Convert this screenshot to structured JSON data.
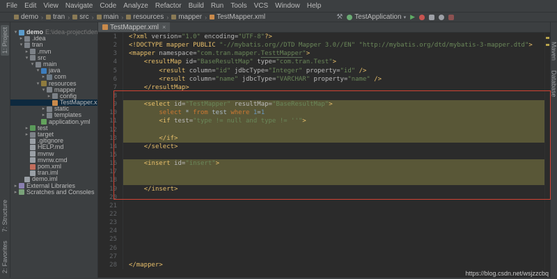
{
  "window": {
    "menu": [
      "File",
      "Edit",
      "View",
      "Navigate",
      "Code",
      "Analyze",
      "Refactor",
      "Build",
      "Run",
      "Tools",
      "VCS",
      "Window",
      "Help"
    ],
    "breadcrumbs": [
      "demo",
      "tran",
      "src",
      "main",
      "resources",
      "mapper",
      "TestMapper.xml"
    ],
    "run_config": "TestApplication",
    "watermark": "https://blog.csdn.net/wsjzzcbq"
  },
  "strips": {
    "left_top": [
      "1: Project"
    ],
    "left_bottom": [
      "7: Structure",
      "2: Favorites"
    ],
    "right": [
      "Maven",
      "Database"
    ]
  },
  "project": {
    "tree": [
      {
        "label": "demo",
        "hint": "E:\\idea-project\\demo",
        "level": 0,
        "arrow": "down",
        "icon": "project",
        "bold": true
      },
      {
        "label": ".idea",
        "level": 1,
        "arrow": "right",
        "icon": "folder"
      },
      {
        "label": "tran",
        "level": 1,
        "arrow": "down",
        "icon": "folder"
      },
      {
        "label": ".mvn",
        "level": 2,
        "arrow": "right",
        "icon": "folder"
      },
      {
        "label": "src",
        "level": 2,
        "arrow": "down",
        "icon": "folder"
      },
      {
        "label": "main",
        "level": 3,
        "arrow": "down",
        "icon": "folder"
      },
      {
        "label": "java",
        "level": 4,
        "arrow": "down",
        "icon": "src"
      },
      {
        "label": "com",
        "level": 5,
        "arrow": "right",
        "icon": "package"
      },
      {
        "label": "resources",
        "level": 4,
        "arrow": "down",
        "icon": "res"
      },
      {
        "label": "mapper",
        "level": 5,
        "arrow": "down",
        "icon": "folder"
      },
      {
        "label": "config",
        "level": 6,
        "arrow": "right",
        "icon": "folder"
      },
      {
        "label": "TestMapper.xml",
        "level": 6,
        "icon": "xml",
        "selected": true
      },
      {
        "label": "static",
        "level": 5,
        "arrow": "right",
        "icon": "folder"
      },
      {
        "label": "templates",
        "level": 5,
        "arrow": "right",
        "icon": "folder"
      },
      {
        "label": "application.yml",
        "level": 4,
        "icon": "yml"
      },
      {
        "label": "test",
        "level": 2,
        "arrow": "right",
        "icon": "testfolder"
      },
      {
        "label": "target",
        "level": 2,
        "arrow": "right",
        "icon": "folder"
      },
      {
        "label": ".gitignore",
        "level": 2,
        "icon": "file"
      },
      {
        "label": "HELP.md",
        "level": 2,
        "icon": "file"
      },
      {
        "label": "mvnw",
        "level": 2,
        "icon": "file"
      },
      {
        "label": "mvnw.cmd",
        "level": 2,
        "icon": "file"
      },
      {
        "label": "pom.xml",
        "level": 2,
        "icon": "maven"
      },
      {
        "label": "tran.iml",
        "level": 2,
        "icon": "file"
      },
      {
        "label": "demo.iml",
        "level": 1,
        "icon": "file"
      },
      {
        "label": "External Libraries",
        "level": 0,
        "arrow": "right",
        "icon": "lib"
      },
      {
        "label": "Scratches and Consoles",
        "level": 0,
        "arrow": "right",
        "icon": "scratch"
      }
    ]
  },
  "editor": {
    "tab": "TestMapper.xml",
    "lines": [
      {
        "n": 1,
        "seg": [
          [
            "t",
            "<?xml "
          ],
          [
            "a",
            "version="
          ],
          [
            "s",
            "\"1.0\""
          ],
          [
            "a",
            " encoding="
          ],
          [
            "s",
            "\"UTF-8\""
          ],
          [
            "t",
            "?>"
          ]
        ]
      },
      {
        "n": 2,
        "seg": [
          [
            "t",
            "<!DOCTYPE mapper PUBLIC "
          ],
          [
            "s",
            "\"-//mybatis.org//DTD Mapper 3.0//EN\""
          ],
          [
            "p",
            " "
          ],
          [
            "s",
            "\"http://mybatis.org/dtd/mybatis-3-mapper.dtd\""
          ],
          [
            "t",
            ">"
          ]
        ]
      },
      {
        "n": 3,
        "seg": [
          [
            "t",
            "<mapper "
          ],
          [
            "a",
            "namespace="
          ],
          [
            "s",
            "\"com.tran.mapper."
          ],
          [
            "su",
            "TesttMapper"
          ],
          [
            "s",
            "\""
          ],
          [
            "t",
            ">"
          ]
        ]
      },
      {
        "n": 4,
        "seg": [
          [
            "p",
            "    "
          ],
          [
            "t",
            "<resultMap "
          ],
          [
            "a",
            "id="
          ],
          [
            "s",
            "\"BaseResultMap\""
          ],
          [
            "a",
            " type="
          ],
          [
            "s",
            "\"com.tran.Test\""
          ],
          [
            "t",
            ">"
          ]
        ]
      },
      {
        "n": 5,
        "seg": [
          [
            "p",
            "        "
          ],
          [
            "t",
            "<result "
          ],
          [
            "a",
            "column="
          ],
          [
            "s",
            "\"id\""
          ],
          [
            "a",
            " jdbcType="
          ],
          [
            "s",
            "\"Integer\""
          ],
          [
            "a",
            " property="
          ],
          [
            "s",
            "\"id\""
          ],
          [
            "t",
            " />"
          ]
        ]
      },
      {
        "n": 6,
        "seg": [
          [
            "p",
            "        "
          ],
          [
            "t",
            "<result "
          ],
          [
            "a",
            "column="
          ],
          [
            "s",
            "\"name\""
          ],
          [
            "a",
            " jdbcType="
          ],
          [
            "s",
            "\"VARCHAR\""
          ],
          [
            "a",
            " property="
          ],
          [
            "s",
            "\"name\""
          ],
          [
            "t",
            " />"
          ]
        ]
      },
      {
        "n": 7,
        "seg": [
          [
            "p",
            "    "
          ],
          [
            "t",
            "</resultMap>"
          ]
        ]
      },
      {
        "n": 8,
        "seg": []
      },
      {
        "n": 9,
        "hl": true,
        "seg": [
          [
            "p",
            "    "
          ],
          [
            "t",
            "<select "
          ],
          [
            "a",
            "id="
          ],
          [
            "s",
            "\"TestMapper\""
          ],
          [
            "a",
            " resultMap="
          ],
          [
            "s",
            "\"BaseResultMap\""
          ],
          [
            "t",
            ">"
          ]
        ]
      },
      {
        "n": 10,
        "hl": true,
        "seg": [
          [
            "p",
            "        "
          ],
          [
            "k",
            "select"
          ],
          [
            "p",
            " * "
          ],
          [
            "k",
            "from"
          ],
          [
            "p",
            " test "
          ],
          [
            "k",
            "where"
          ],
          [
            "p",
            " "
          ],
          [
            "d",
            "1"
          ],
          [
            "p",
            "="
          ],
          [
            "d",
            "1"
          ]
        ]
      },
      {
        "n": 11,
        "hl": true,
        "seg": [
          [
            "p",
            "        "
          ],
          [
            "t",
            "<if "
          ],
          [
            "a",
            "test="
          ],
          [
            "s",
            "\"type != null and type != ''\""
          ],
          [
            "t",
            ">"
          ]
        ]
      },
      {
        "n": 12,
        "hl": true,
        "seg": []
      },
      {
        "n": 13,
        "hl": true,
        "seg": [
          [
            "p",
            "        "
          ],
          [
            "t",
            "</if>"
          ]
        ]
      },
      {
        "n": 14,
        "seg": [
          [
            "p",
            "    "
          ],
          [
            "t",
            "</select>"
          ]
        ]
      },
      {
        "n": 15,
        "seg": []
      },
      {
        "n": 16,
        "hl": true,
        "seg": [
          [
            "p",
            "    "
          ],
          [
            "t",
            "<insert "
          ],
          [
            "a",
            "id="
          ],
          [
            "s",
            "\"insert\""
          ],
          [
            "t",
            ">"
          ]
        ]
      },
      {
        "n": 17,
        "hl": true,
        "seg": []
      },
      {
        "n": 18,
        "hl": true,
        "seg": []
      },
      {
        "n": 19,
        "seg": [
          [
            "p",
            "    "
          ],
          [
            "t",
            "</insert>"
          ]
        ]
      },
      {
        "n": 20,
        "seg": []
      },
      {
        "n": 21,
        "seg": []
      },
      {
        "n": 22,
        "seg": []
      },
      {
        "n": 23,
        "seg": []
      },
      {
        "n": 24,
        "seg": []
      },
      {
        "n": 25,
        "seg": []
      },
      {
        "n": 26,
        "seg": []
      },
      {
        "n": 27,
        "seg": []
      },
      {
        "n": 28,
        "seg": [
          [
            "t",
            "</mapper>"
          ]
        ]
      }
    ]
  },
  "palette": {
    "editor_bg": "#2b2b2b",
    "panel_bg": "#3c3f41",
    "tag": "#e8bf6a",
    "attr": "#bababa",
    "string": "#6a8759",
    "keyword": "#cc7832",
    "number": "#6897bb",
    "highlight_block": "#595737",
    "annotation_red": "#d14334"
  }
}
